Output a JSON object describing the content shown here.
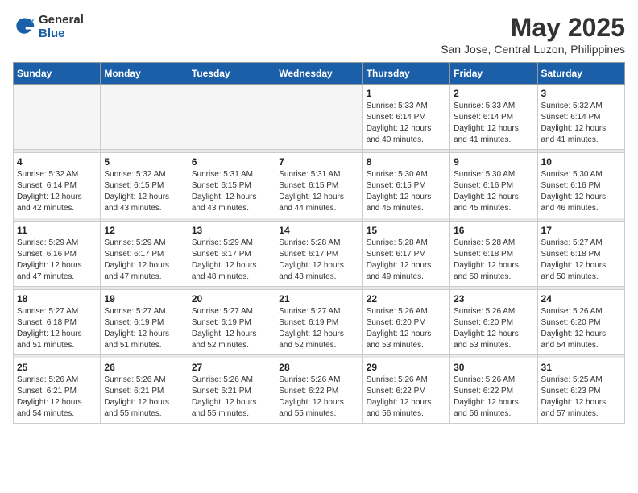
{
  "header": {
    "logo_line1": "General",
    "logo_line2": "Blue",
    "month_title": "May 2025",
    "subtitle": "San Jose, Central Luzon, Philippines"
  },
  "weekdays": [
    "Sunday",
    "Monday",
    "Tuesday",
    "Wednesday",
    "Thursday",
    "Friday",
    "Saturday"
  ],
  "weeks": [
    [
      {
        "day": "",
        "info": ""
      },
      {
        "day": "",
        "info": ""
      },
      {
        "day": "",
        "info": ""
      },
      {
        "day": "",
        "info": ""
      },
      {
        "day": "1",
        "info": "Sunrise: 5:33 AM\nSunset: 6:14 PM\nDaylight: 12 hours\nand 40 minutes."
      },
      {
        "day": "2",
        "info": "Sunrise: 5:33 AM\nSunset: 6:14 PM\nDaylight: 12 hours\nand 41 minutes."
      },
      {
        "day": "3",
        "info": "Sunrise: 5:32 AM\nSunset: 6:14 PM\nDaylight: 12 hours\nand 41 minutes."
      }
    ],
    [
      {
        "day": "4",
        "info": "Sunrise: 5:32 AM\nSunset: 6:14 PM\nDaylight: 12 hours\nand 42 minutes."
      },
      {
        "day": "5",
        "info": "Sunrise: 5:32 AM\nSunset: 6:15 PM\nDaylight: 12 hours\nand 43 minutes."
      },
      {
        "day": "6",
        "info": "Sunrise: 5:31 AM\nSunset: 6:15 PM\nDaylight: 12 hours\nand 43 minutes."
      },
      {
        "day": "7",
        "info": "Sunrise: 5:31 AM\nSunset: 6:15 PM\nDaylight: 12 hours\nand 44 minutes."
      },
      {
        "day": "8",
        "info": "Sunrise: 5:30 AM\nSunset: 6:15 PM\nDaylight: 12 hours\nand 45 minutes."
      },
      {
        "day": "9",
        "info": "Sunrise: 5:30 AM\nSunset: 6:16 PM\nDaylight: 12 hours\nand 45 minutes."
      },
      {
        "day": "10",
        "info": "Sunrise: 5:30 AM\nSunset: 6:16 PM\nDaylight: 12 hours\nand 46 minutes."
      }
    ],
    [
      {
        "day": "11",
        "info": "Sunrise: 5:29 AM\nSunset: 6:16 PM\nDaylight: 12 hours\nand 47 minutes."
      },
      {
        "day": "12",
        "info": "Sunrise: 5:29 AM\nSunset: 6:17 PM\nDaylight: 12 hours\nand 47 minutes."
      },
      {
        "day": "13",
        "info": "Sunrise: 5:29 AM\nSunset: 6:17 PM\nDaylight: 12 hours\nand 48 minutes."
      },
      {
        "day": "14",
        "info": "Sunrise: 5:28 AM\nSunset: 6:17 PM\nDaylight: 12 hours\nand 48 minutes."
      },
      {
        "day": "15",
        "info": "Sunrise: 5:28 AM\nSunset: 6:17 PM\nDaylight: 12 hours\nand 49 minutes."
      },
      {
        "day": "16",
        "info": "Sunrise: 5:28 AM\nSunset: 6:18 PM\nDaylight: 12 hours\nand 50 minutes."
      },
      {
        "day": "17",
        "info": "Sunrise: 5:27 AM\nSunset: 6:18 PM\nDaylight: 12 hours\nand 50 minutes."
      }
    ],
    [
      {
        "day": "18",
        "info": "Sunrise: 5:27 AM\nSunset: 6:18 PM\nDaylight: 12 hours\nand 51 minutes."
      },
      {
        "day": "19",
        "info": "Sunrise: 5:27 AM\nSunset: 6:19 PM\nDaylight: 12 hours\nand 51 minutes."
      },
      {
        "day": "20",
        "info": "Sunrise: 5:27 AM\nSunset: 6:19 PM\nDaylight: 12 hours\nand 52 minutes."
      },
      {
        "day": "21",
        "info": "Sunrise: 5:27 AM\nSunset: 6:19 PM\nDaylight: 12 hours\nand 52 minutes."
      },
      {
        "day": "22",
        "info": "Sunrise: 5:26 AM\nSunset: 6:20 PM\nDaylight: 12 hours\nand 53 minutes."
      },
      {
        "day": "23",
        "info": "Sunrise: 5:26 AM\nSunset: 6:20 PM\nDaylight: 12 hours\nand 53 minutes."
      },
      {
        "day": "24",
        "info": "Sunrise: 5:26 AM\nSunset: 6:20 PM\nDaylight: 12 hours\nand 54 minutes."
      }
    ],
    [
      {
        "day": "25",
        "info": "Sunrise: 5:26 AM\nSunset: 6:21 PM\nDaylight: 12 hours\nand 54 minutes."
      },
      {
        "day": "26",
        "info": "Sunrise: 5:26 AM\nSunset: 6:21 PM\nDaylight: 12 hours\nand 55 minutes."
      },
      {
        "day": "27",
        "info": "Sunrise: 5:26 AM\nSunset: 6:21 PM\nDaylight: 12 hours\nand 55 minutes."
      },
      {
        "day": "28",
        "info": "Sunrise: 5:26 AM\nSunset: 6:22 PM\nDaylight: 12 hours\nand 55 minutes."
      },
      {
        "day": "29",
        "info": "Sunrise: 5:26 AM\nSunset: 6:22 PM\nDaylight: 12 hours\nand 56 minutes."
      },
      {
        "day": "30",
        "info": "Sunrise: 5:26 AM\nSunset: 6:22 PM\nDaylight: 12 hours\nand 56 minutes."
      },
      {
        "day": "31",
        "info": "Sunrise: 5:25 AM\nSunset: 6:23 PM\nDaylight: 12 hours\nand 57 minutes."
      }
    ]
  ]
}
